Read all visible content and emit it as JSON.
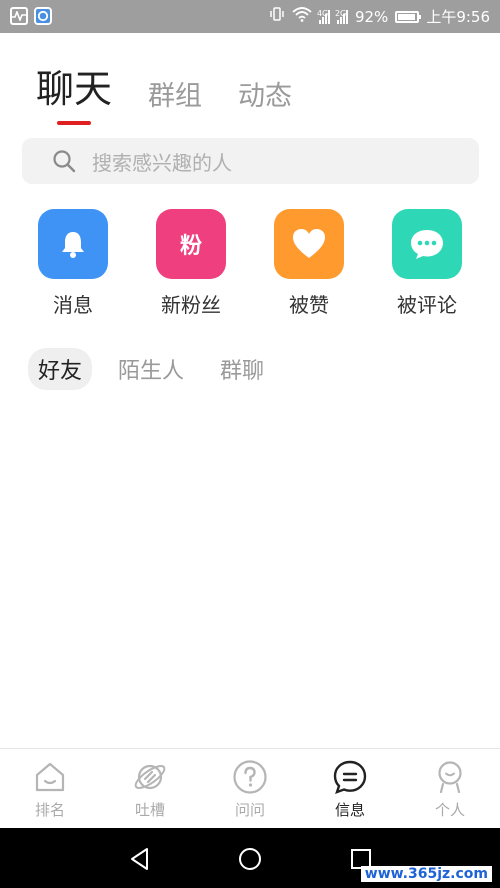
{
  "status_bar": {
    "battery": "92%",
    "time": "上午9:56",
    "net_labels": [
      "4G",
      "2G"
    ],
    "battery_level": 0.92
  },
  "top_tabs": [
    {
      "label": "聊天",
      "active": true
    },
    {
      "label": "群组",
      "active": false
    },
    {
      "label": "动态",
      "active": false
    }
  ],
  "search": {
    "placeholder": "搜索感兴趣的人"
  },
  "actions": [
    {
      "label": "消息",
      "color": "#3f93f5",
      "icon": "bell-icon"
    },
    {
      "label": "新粉丝",
      "color": "#ef3f7e",
      "icon": "fen-icon",
      "glyph": "粉"
    },
    {
      "label": "被赞",
      "color": "#ff9a2e",
      "icon": "heart-icon"
    },
    {
      "label": "被评论",
      "color": "#2ed8b6",
      "icon": "comment-bubble-icon"
    }
  ],
  "sub_tabs": [
    {
      "label": "好友",
      "active": true
    },
    {
      "label": "陌生人",
      "active": false
    },
    {
      "label": "群聊",
      "active": false
    }
  ],
  "bottom_nav": [
    {
      "label": "排名",
      "icon": "house-icon",
      "active": false
    },
    {
      "label": "吐槽",
      "icon": "planet-icon",
      "active": false
    },
    {
      "label": "问问",
      "icon": "question-icon",
      "active": false
    },
    {
      "label": "信息",
      "icon": "message-icon",
      "active": true
    },
    {
      "label": "个人",
      "icon": "person-icon",
      "active": false
    }
  ],
  "watermark": "www.365jz.com"
}
